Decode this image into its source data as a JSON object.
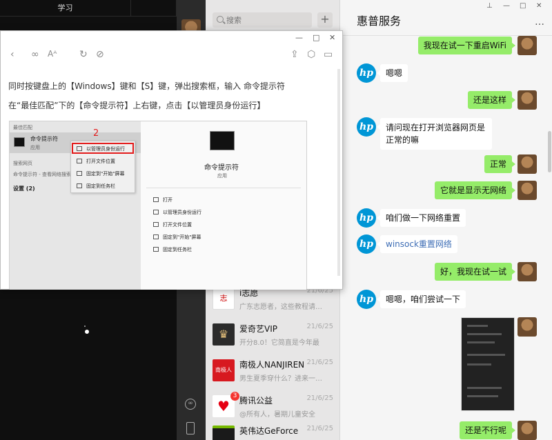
{
  "left_panel": {
    "tab_label": "学习"
  },
  "search": {
    "placeholder": "搜索",
    "add_label": "+"
  },
  "conversations": [
    {
      "name": "i志愿",
      "date": "21/6/25",
      "preview": "广东志愿者，这些教程请收好",
      "avatar_color": "#ffffff"
    },
    {
      "name": "爱奇艺VIP",
      "date": "21/6/25",
      "preview": "开分8.0！它简直是今年最",
      "avatar_color": "#2b2b2b"
    },
    {
      "name": "南极人NANJIREN",
      "date": "21/6/25",
      "preview": "男生夏季穿什么？进来一起看",
      "avatar_color": "#d71920"
    },
    {
      "name": "腾讯公益",
      "date": "21/6/25",
      "preview": "@所有人，暑期儿童安全",
      "avatar_color": "#ffffff",
      "badge": "3"
    },
    {
      "name": "英伟达GeForce",
      "date": "21/6/25",
      "preview": "",
      "avatar_color": "#1a1a1a"
    }
  ],
  "chat": {
    "title": "惠普服务",
    "more": "…",
    "window_controls": {
      "pin": "⊥",
      "minimize": "—",
      "maximize": "□",
      "close": "✕"
    },
    "messages": [
      {
        "side": "right",
        "text": "我现在试一下重启WiFi"
      },
      {
        "side": "left",
        "text": "嗯嗯"
      },
      {
        "side": "right",
        "text": "还是这样"
      },
      {
        "side": "left",
        "text": "请问现在打开浏览器网页是正常的嘛"
      },
      {
        "side": "right",
        "text": "正常"
      },
      {
        "side": "right",
        "text": "它就是显示无网络"
      },
      {
        "side": "left",
        "text": "咱们做一下网络重置"
      },
      {
        "side": "left",
        "text": "winsock重置网络"
      },
      {
        "side": "right",
        "text": "好，我现在试一试"
      },
      {
        "side": "left",
        "text": "嗯嗯，咱们尝试一下"
      },
      {
        "side": "right",
        "text": "还是不行呢"
      }
    ],
    "hp_logo": "hp",
    "accent": "#95ec69"
  },
  "tutorial": {
    "titlebar": {
      "minimize": "—",
      "maximize": "□",
      "close": "✕"
    },
    "line1": "同时按键盘上的【Windows】键和【S】键，弹出搜索框，输入 命令提示符",
    "line2": "在“最佳匹配”下的【命令提示符】上右键，点击【以管理员身份运行】",
    "screenshot": {
      "best_match": "最佳匹配",
      "app_name": "命令提示符",
      "app_type": "应用",
      "web_search": "搜索网页",
      "web_item": "命令提示符 - 查看网络搜索结果",
      "settings": "设置 (2)",
      "step": "2",
      "context_menu": [
        "以管理员身份运行",
        "打开文件位置",
        "固定到\"开始\"屏幕",
        "固定到任务栏"
      ],
      "right_title": "命令提示符",
      "right_type": "应用",
      "right_actions": [
        "打开",
        "以管理员身份运行",
        "打开文件位置",
        "固定到\"开始\"屏幕",
        "固定到任务栏"
      ]
    }
  }
}
